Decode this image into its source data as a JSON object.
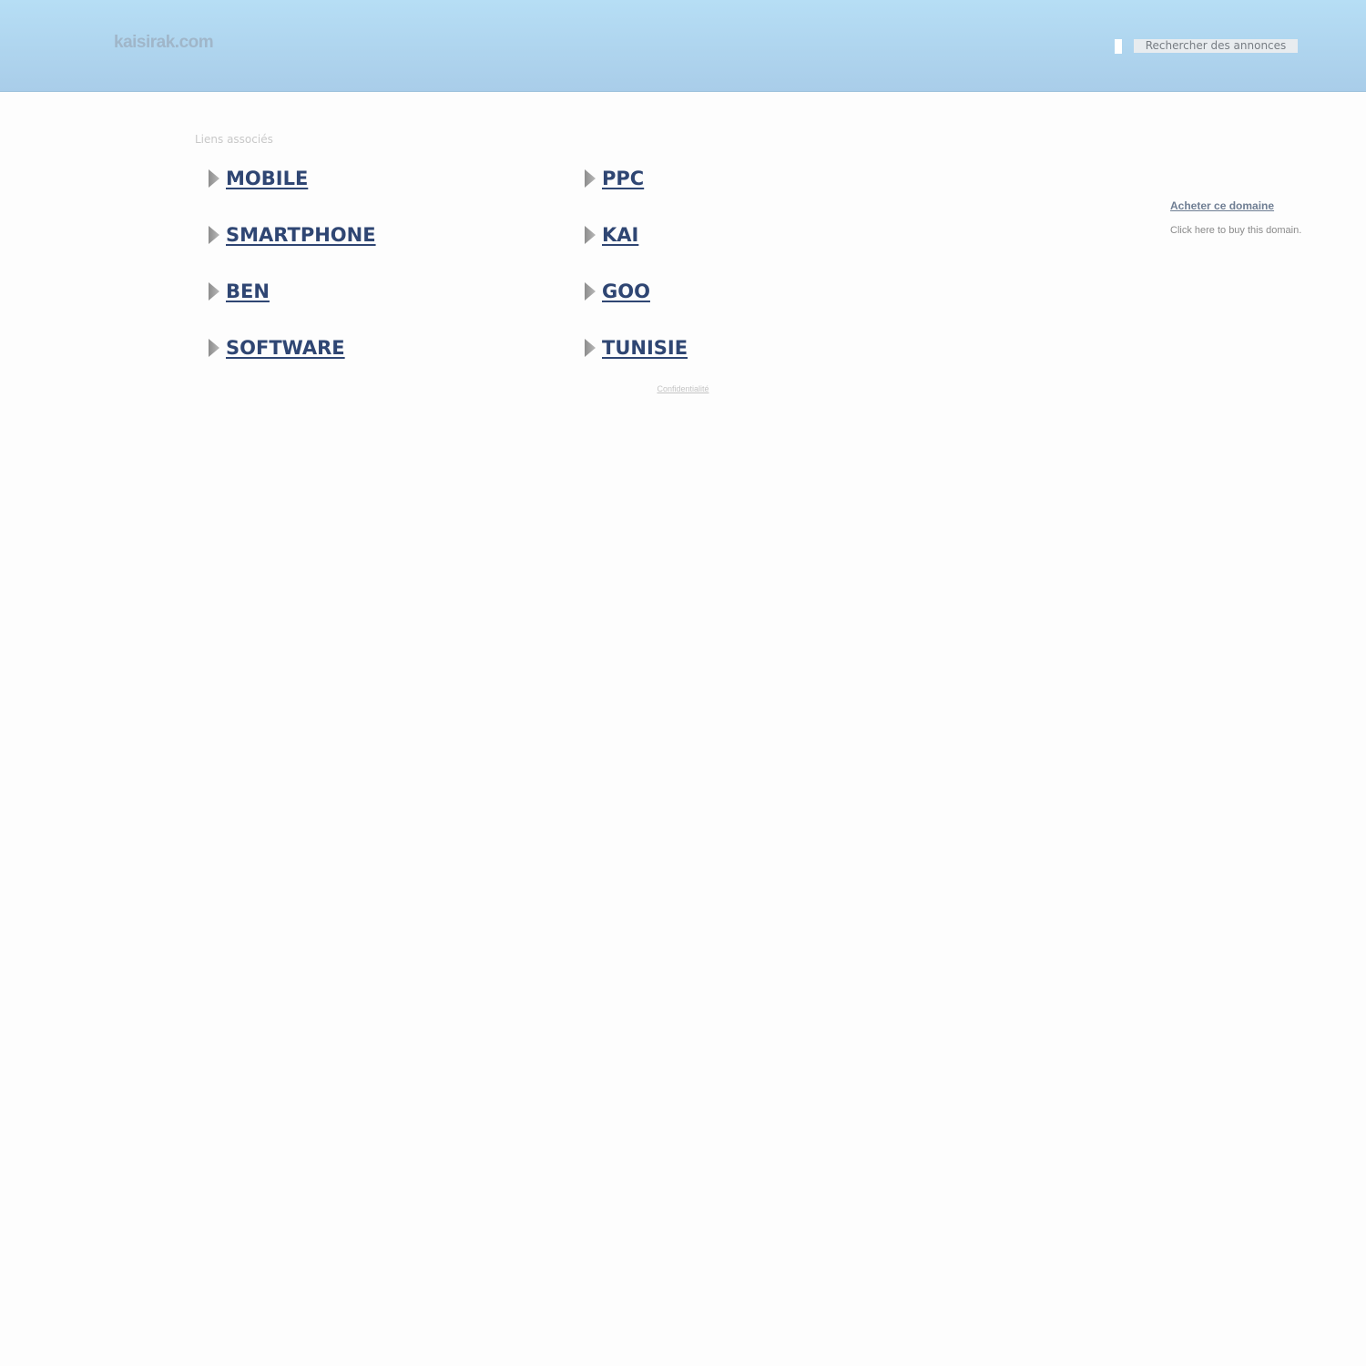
{
  "header": {
    "logo_text": "kaisirak.com",
    "search_button_label": "Rechercher des annonces"
  },
  "main": {
    "related_title": "Liens associés",
    "links": [
      "MOBILE",
      "PPC",
      "SMARTPHONE",
      "KAI",
      "BEN",
      "GOO",
      "SOFTWARE",
      "TUNISIE"
    ],
    "privacy_label": "Confidentialité"
  },
  "sidebar": {
    "buy_link_label": "Acheter ce domaine",
    "buy_description": "Click here to buy this domain."
  },
  "icons": {
    "link_bullet": "arrow-right-icon"
  },
  "colors": {
    "header_top": "#b6def5",
    "header_bottom": "#a9cde9",
    "link": "#2f4673",
    "background": "#fdfdfd"
  }
}
